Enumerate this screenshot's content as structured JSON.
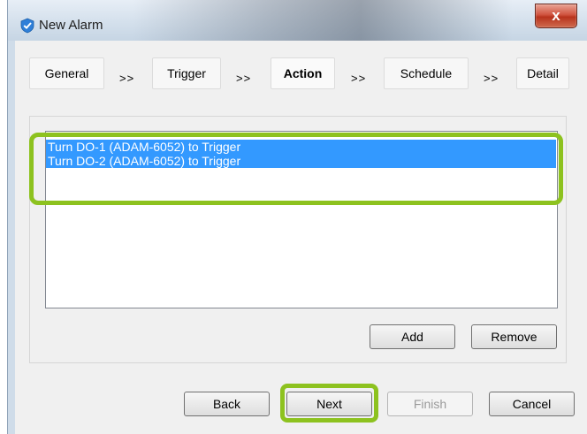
{
  "window": {
    "title": "New Alarm",
    "close_glyph": "x",
    "icon": "shield-check-icon"
  },
  "steps": [
    {
      "label": "General",
      "active": false
    },
    {
      "label": "Trigger",
      "active": false
    },
    {
      "label": "Action",
      "active": true
    },
    {
      "label": "Schedule",
      "active": false
    },
    {
      "label": "Detail",
      "active": false
    }
  ],
  "step_separator": ">>",
  "actions": {
    "items": [
      "Turn DO-1 (ADAM-6052) to Trigger",
      "Turn DO-2 (ADAM-6052) to Trigger"
    ],
    "add_label": "Add",
    "remove_label": "Remove"
  },
  "footer": {
    "back_label": "Back",
    "next_label": "Next",
    "finish_label": "Finish",
    "cancel_label": "Cancel"
  },
  "colors": {
    "highlight": "#8dc21f",
    "selection": "#3399ff"
  }
}
